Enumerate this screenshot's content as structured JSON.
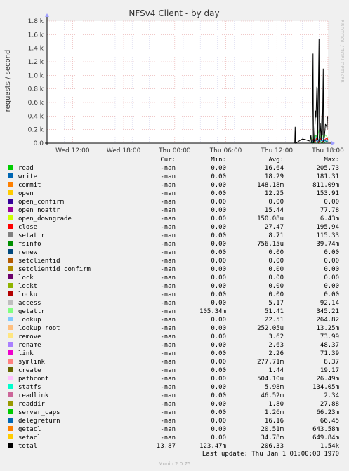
{
  "colors": {
    "background": "#f0f0f0",
    "plot_background": "#ffffff",
    "major_grid": "#e8a8a8",
    "minor_grid": "#c8c8e8",
    "axis": "#000000"
  },
  "chart_data": {
    "type": "line",
    "title": "NFSv4 Client - by day",
    "ylabel": "requests / second",
    "side_text": "RRDTOOL / TOBI OETIKER",
    "ylim": [
      0,
      1800
    ],
    "yticks": [
      {
        "value": 0,
        "label": "0.0"
      },
      {
        "value": 200,
        "label": "0.2 k"
      },
      {
        "value": 400,
        "label": "0.4 k"
      },
      {
        "value": 600,
        "label": "0.6 k"
      },
      {
        "value": 800,
        "label": "0.8 k"
      },
      {
        "value": 1000,
        "label": "1.0 k"
      },
      {
        "value": 1200,
        "label": "1.2 k"
      },
      {
        "value": 1400,
        "label": "1.4 k"
      },
      {
        "value": 1600,
        "label": "1.6 k"
      },
      {
        "value": 1800,
        "label": "1.8 k"
      }
    ],
    "xlim_hours": [
      -27.0,
      6.0
    ],
    "xticks": [
      {
        "hour": -24,
        "label": "Wed 12:00"
      },
      {
        "hour": -18,
        "label": "Wed 18:00"
      },
      {
        "hour": -12,
        "label": "Thu 00:00"
      },
      {
        "hour": -6,
        "label": "Thu 06:00"
      },
      {
        "hour": 0,
        "label": "Thu 12:00"
      },
      {
        "hour": 6,
        "label": "Thu 18:00"
      }
    ],
    "grid": true,
    "legend_columns": [
      "",
      "Cur:",
      "Min:",
      "Avg:",
      "Max:"
    ],
    "series": [
      {
        "name": "read",
        "color": "#00cc00",
        "cur": "-nan",
        "min": "0.00",
        "avg": "16.64",
        "max": "205.73"
      },
      {
        "name": "write",
        "color": "#0066b3",
        "cur": "-nan",
        "min": "0.00",
        "avg": "18.29",
        "max": "181.31"
      },
      {
        "name": "commit",
        "color": "#ff8000",
        "cur": "-nan",
        "min": "0.00",
        "avg": "148.18m",
        "max": "811.09m"
      },
      {
        "name": "open",
        "color": "#ffcc00",
        "cur": "-nan",
        "min": "0.00",
        "avg": "12.25",
        "max": "153.91"
      },
      {
        "name": "open_confirm",
        "color": "#330099",
        "cur": "-nan",
        "min": "0.00",
        "avg": "0.00",
        "max": "0.00"
      },
      {
        "name": "open_noattr",
        "color": "#990099",
        "cur": "-nan",
        "min": "0.00",
        "avg": "15.44",
        "max": "77.78"
      },
      {
        "name": "open_downgrade",
        "color": "#ccff00",
        "cur": "-nan",
        "min": "0.00",
        "avg": "150.08u",
        "max": "6.43m"
      },
      {
        "name": "close",
        "color": "#ff0000",
        "cur": "-nan",
        "min": "0.00",
        "avg": "27.47",
        "max": "195.94"
      },
      {
        "name": "setattr",
        "color": "#808080",
        "cur": "-nan",
        "min": "0.00",
        "avg": "8.71",
        "max": "115.33"
      },
      {
        "name": "fsinfo",
        "color": "#008f00",
        "cur": "-nan",
        "min": "0.00",
        "avg": "756.15u",
        "max": "39.74m"
      },
      {
        "name": "renew",
        "color": "#00487d",
        "cur": "-nan",
        "min": "0.00",
        "avg": "0.00",
        "max": "0.00"
      },
      {
        "name": "setclientid",
        "color": "#b35a00",
        "cur": "-nan",
        "min": "0.00",
        "avg": "0.00",
        "max": "0.00"
      },
      {
        "name": "setclientid_confirm",
        "color": "#b38f00",
        "cur": "-nan",
        "min": "0.00",
        "avg": "0.00",
        "max": "0.00"
      },
      {
        "name": "lock",
        "color": "#6b006b",
        "cur": "-nan",
        "min": "0.00",
        "avg": "0.00",
        "max": "0.00"
      },
      {
        "name": "lockt",
        "color": "#8fb300",
        "cur": "-nan",
        "min": "0.00",
        "avg": "0.00",
        "max": "0.00"
      },
      {
        "name": "locku",
        "color": "#b30000",
        "cur": "-nan",
        "min": "0.00",
        "avg": "0.00",
        "max": "0.00"
      },
      {
        "name": "access",
        "color": "#bebebe",
        "cur": "-nan",
        "min": "0.00",
        "avg": "5.17",
        "max": "92.14"
      },
      {
        "name": "getattr",
        "color": "#80ff80",
        "cur": "-nan",
        "min": "105.34m",
        "avg": "51.41",
        "max": "345.21"
      },
      {
        "name": "lookup",
        "color": "#80c9ff",
        "cur": "-nan",
        "min": "0.00",
        "avg": "22.51",
        "max": "264.82"
      },
      {
        "name": "lookup_root",
        "color": "#ffc080",
        "cur": "-nan",
        "min": "0.00",
        "avg": "252.05u",
        "max": "13.25m"
      },
      {
        "name": "remove",
        "color": "#ffe680",
        "cur": "-nan",
        "min": "0.00",
        "avg": "3.62",
        "max": "73.99"
      },
      {
        "name": "rename",
        "color": "#aa80ff",
        "cur": "-nan",
        "min": "0.00",
        "avg": "2.63",
        "max": "48.37"
      },
      {
        "name": "link",
        "color": "#ee00cc",
        "cur": "-nan",
        "min": "0.00",
        "avg": "2.26",
        "max": "71.39"
      },
      {
        "name": "symlink",
        "color": "#ff8080",
        "cur": "-nan",
        "min": "0.00",
        "avg": "277.71m",
        "max": "8.37"
      },
      {
        "name": "create",
        "color": "#666600",
        "cur": "-nan",
        "min": "0.00",
        "avg": "1.44",
        "max": "19.17"
      },
      {
        "name": "pathconf",
        "color": "#ffbfff",
        "cur": "-nan",
        "min": "0.00",
        "avg": "504.10u",
        "max": "26.49m"
      },
      {
        "name": "statfs",
        "color": "#00ffcc",
        "cur": "-nan",
        "min": "0.00",
        "avg": "5.98m",
        "max": "134.05m"
      },
      {
        "name": "readlink",
        "color": "#cc6699",
        "cur": "-nan",
        "min": "0.00",
        "avg": "46.52m",
        "max": "2.34"
      },
      {
        "name": "readdir",
        "color": "#999900",
        "cur": "-nan",
        "min": "0.00",
        "avg": "1.80",
        "max": "27.88"
      },
      {
        "name": "server_caps",
        "color": "#00cc00",
        "cur": "-nan",
        "min": "0.00",
        "avg": "1.26m",
        "max": "66.23m"
      },
      {
        "name": "delegreturn",
        "color": "#0066b3",
        "cur": "-nan",
        "min": "0.00",
        "avg": "16.16",
        "max": "66.45"
      },
      {
        "name": "getacl",
        "color": "#ff8000",
        "cur": "-nan",
        "min": "0.00",
        "avg": "20.51m",
        "max": "643.58m"
      },
      {
        "name": "setacl",
        "color": "#ffcc00",
        "cur": "-nan",
        "min": "0.00",
        "avg": "34.78m",
        "max": "649.84m"
      },
      {
        "name": "total",
        "color": "#000000",
        "cur": "13.87",
        "min": "123.47m",
        "avg": "206.33",
        "max": "1.54k"
      }
    ],
    "total_points": [
      [
        2.1,
        0
      ],
      [
        2.15,
        240
      ],
      [
        2.2,
        0
      ],
      [
        3.0,
        60
      ],
      [
        3.3,
        55
      ],
      [
        3.6,
        40
      ],
      [
        3.9,
        30
      ],
      [
        4.0,
        120
      ],
      [
        4.05,
        20
      ],
      [
        4.15,
        0
      ],
      [
        4.25,
        1320
      ],
      [
        4.3,
        0
      ],
      [
        4.4,
        40
      ],
      [
        4.55,
        480
      ],
      [
        4.6,
        380
      ],
      [
        4.7,
        830
      ],
      [
        4.75,
        800
      ],
      [
        4.8,
        50
      ],
      [
        4.95,
        1540
      ],
      [
        5.0,
        10
      ],
      [
        5.1,
        300
      ],
      [
        5.2,
        40
      ],
      [
        5.3,
        450
      ],
      [
        5.35,
        120
      ],
      [
        5.45,
        1100
      ],
      [
        5.5,
        10
      ],
      [
        5.6,
        120
      ],
      [
        5.7,
        280
      ],
      [
        5.8,
        260
      ],
      [
        5.85,
        240
      ],
      [
        5.9,
        200
      ],
      [
        5.95,
        390
      ],
      [
        6.0,
        380
      ]
    ],
    "bottom_series_points": [
      {
        "series": "read",
        "points": [
          [
            4.1,
            0
          ],
          [
            4.15,
            110
          ],
          [
            4.2,
            10
          ],
          [
            4.5,
            0
          ],
          [
            4.6,
            120
          ],
          [
            4.7,
            30
          ],
          [
            4.9,
            0
          ],
          [
            5.0,
            130
          ],
          [
            5.1,
            20
          ],
          [
            5.4,
            0
          ],
          [
            5.5,
            90
          ],
          [
            5.6,
            10
          ],
          [
            6.0,
            40
          ]
        ]
      },
      {
        "series": "getattr",
        "points": [
          [
            4.0,
            0
          ],
          [
            4.1,
            80
          ],
          [
            4.3,
            40
          ],
          [
            4.45,
            140
          ],
          [
            4.6,
            60
          ],
          [
            4.8,
            110
          ],
          [
            4.95,
            200
          ],
          [
            5.1,
            70
          ],
          [
            5.3,
            150
          ],
          [
            5.5,
            60
          ],
          [
            5.7,
            120
          ],
          [
            5.9,
            90
          ],
          [
            6.0,
            50
          ]
        ]
      },
      {
        "series": "lookup",
        "points": [
          [
            4.0,
            0
          ],
          [
            4.2,
            50
          ],
          [
            4.4,
            20
          ],
          [
            4.6,
            90
          ],
          [
            4.8,
            40
          ],
          [
            5.0,
            70
          ],
          [
            5.2,
            30
          ],
          [
            5.4,
            80
          ],
          [
            5.6,
            20
          ],
          [
            5.8,
            60
          ],
          [
            6.0,
            30
          ]
        ]
      },
      {
        "series": "close",
        "points": [
          [
            4.0,
            0
          ],
          [
            4.3,
            60
          ],
          [
            4.5,
            20
          ],
          [
            4.75,
            100
          ],
          [
            4.9,
            10
          ],
          [
            5.15,
            70
          ],
          [
            5.35,
            20
          ],
          [
            5.6,
            50
          ],
          [
            5.9,
            80
          ],
          [
            6.0,
            40
          ]
        ]
      },
      {
        "series": "delegreturn",
        "points": [
          [
            4.0,
            0
          ],
          [
            4.2,
            30
          ],
          [
            4.5,
            50
          ],
          [
            4.8,
            20
          ],
          [
            5.0,
            60
          ],
          [
            5.3,
            30
          ],
          [
            5.6,
            40
          ],
          [
            6.0,
            20
          ]
        ]
      }
    ]
  },
  "footer": {
    "last_update": "Last update: Thu Jan  1 01:00:00 1970",
    "version": "Munin 2.0.75"
  }
}
